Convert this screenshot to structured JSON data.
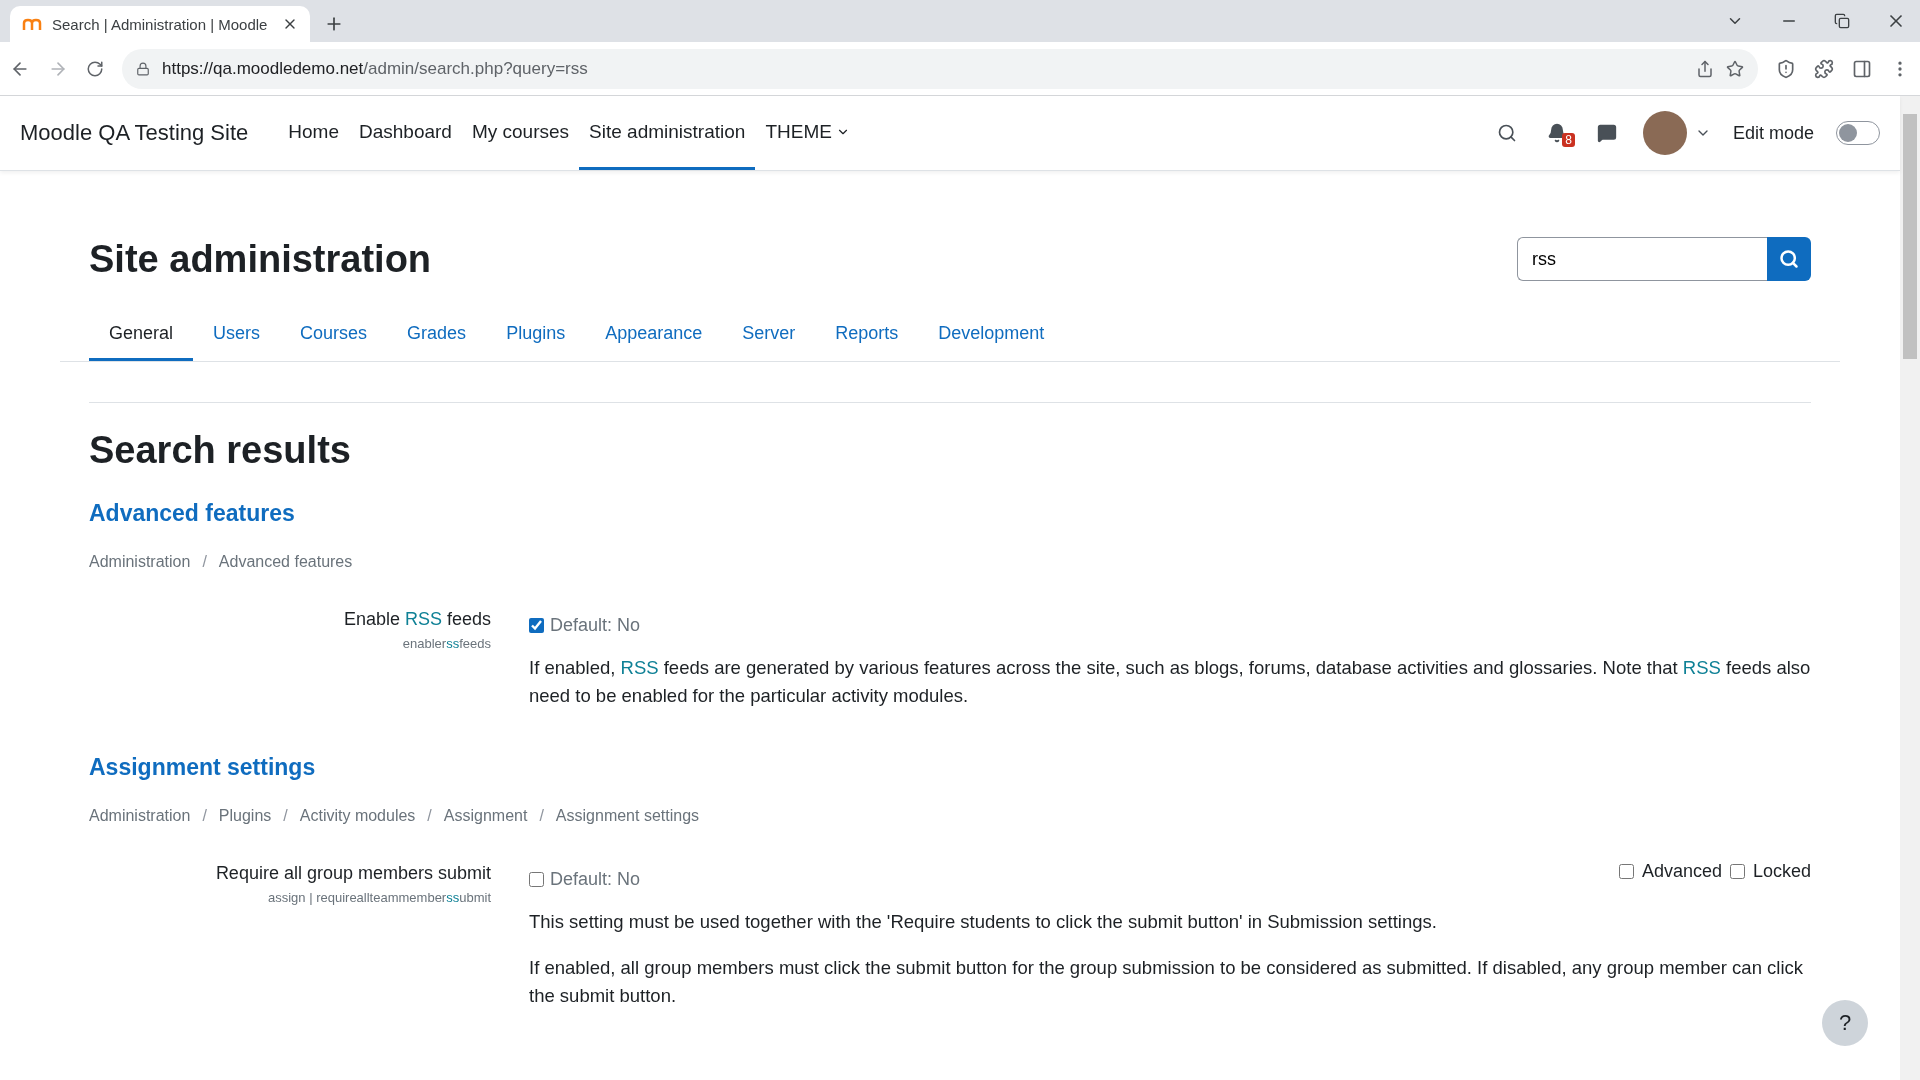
{
  "browser": {
    "tab_title": "Search | Administration | Moodle",
    "url_host": "https://qa.moodledemo.net",
    "url_path": "/admin/search.php?query=rss"
  },
  "navbar": {
    "site_name": "Moodle QA Testing Site",
    "links": [
      {
        "label": "Home",
        "selected": false,
        "kind": "link"
      },
      {
        "label": "Dashboard",
        "selected": false,
        "kind": "link"
      },
      {
        "label": "My courses",
        "selected": false,
        "kind": "link"
      },
      {
        "label": "Site administration",
        "selected": true,
        "kind": "link"
      },
      {
        "label": "THEME",
        "selected": false,
        "kind": "menu"
      }
    ],
    "notification_count": "8",
    "edit_mode": {
      "label": "Edit mode",
      "on": false
    }
  },
  "page": {
    "title": "Site administration",
    "search": {
      "value": "rss"
    },
    "tabs": [
      {
        "label": "General",
        "selected": true
      },
      {
        "label": "Users",
        "selected": false
      },
      {
        "label": "Courses",
        "selected": false
      },
      {
        "label": "Grades",
        "selected": false
      },
      {
        "label": "Plugins",
        "selected": false
      },
      {
        "label": "Appearance",
        "selected": false
      },
      {
        "label": "Server",
        "selected": false
      },
      {
        "label": "Reports",
        "selected": false
      },
      {
        "label": "Development",
        "selected": false
      }
    ],
    "heading": "Search results",
    "sections": [
      {
        "title": "Advanced features",
        "breadcrumb": [
          {
            "kind": "link",
            "text": "Administration"
          },
          {
            "kind": "separator",
            "text": "/"
          },
          {
            "kind": "link",
            "text": "Advanced features"
          }
        ],
        "settings": [
          {
            "label": [
              {
                "text": "Enable ",
                "highlight": false
              },
              {
                "text": "RSS",
                "highlight": true
              },
              {
                "text": " feeds",
                "highlight": false
              }
            ],
            "name": [
              {
                "text": "enabler",
                "highlight": false
              },
              {
                "text": "ss",
                "highlight": true
              },
              {
                "text": "feeds",
                "highlight": false
              }
            ],
            "checked": true,
            "default_text": "Default: No",
            "descriptions": [
              [
                {
                  "text": "If enabled, ",
                  "highlight": false
                },
                {
                  "text": "RSS",
                  "highlight": true
                },
                {
                  "text": " feeds are generated by various features across the site, such as blogs, forums, database activities and glossaries. Note that ",
                  "highlight": false
                },
                {
                  "text": "RSS",
                  "highlight": true
                },
                {
                  "text": " feeds also need to be enabled for the particular activity modules.",
                  "highlight": false
                }
              ]
            ]
          }
        ]
      },
      {
        "title": "Assignment settings",
        "breadcrumb": [
          {
            "kind": "link",
            "text": "Administration"
          },
          {
            "kind": "separator",
            "text": "/"
          },
          {
            "kind": "link",
            "text": "Plugins"
          },
          {
            "kind": "separator",
            "text": "/"
          },
          {
            "kind": "link",
            "text": "Activity modules"
          },
          {
            "kind": "separator",
            "text": "/"
          },
          {
            "kind": "link",
            "text": "Assignment"
          },
          {
            "kind": "separator",
            "text": "/"
          },
          {
            "kind": "link",
            "text": "Assignment settings"
          }
        ],
        "settings": [
          {
            "label": [
              {
                "text": "Require all group members submit",
                "highlight": false
              }
            ],
            "name": [
              {
                "text": "assign | requireallteammember",
                "highlight": false
              },
              {
                "text": "ss",
                "highlight": true
              },
              {
                "text": "ubmit",
                "highlight": false
              }
            ],
            "checked": false,
            "default_text": "Default: No",
            "flags": [
              {
                "label": "Advanced",
                "checked": false
              },
              {
                "label": "Locked",
                "checked": false
              }
            ],
            "descriptions": [
              [
                {
                  "text": "This setting must be used together with the 'Require students to click the submit button' in Submission settings.",
                  "highlight": false
                }
              ],
              [
                {
                  "text": "If enabled, all group members must click the submit button for the group submission to be considered as submitted. If disabled, any group member can click the submit button.",
                  "highlight": false
                }
              ]
            ]
          }
        ]
      }
    ],
    "help_label": "?"
  }
}
